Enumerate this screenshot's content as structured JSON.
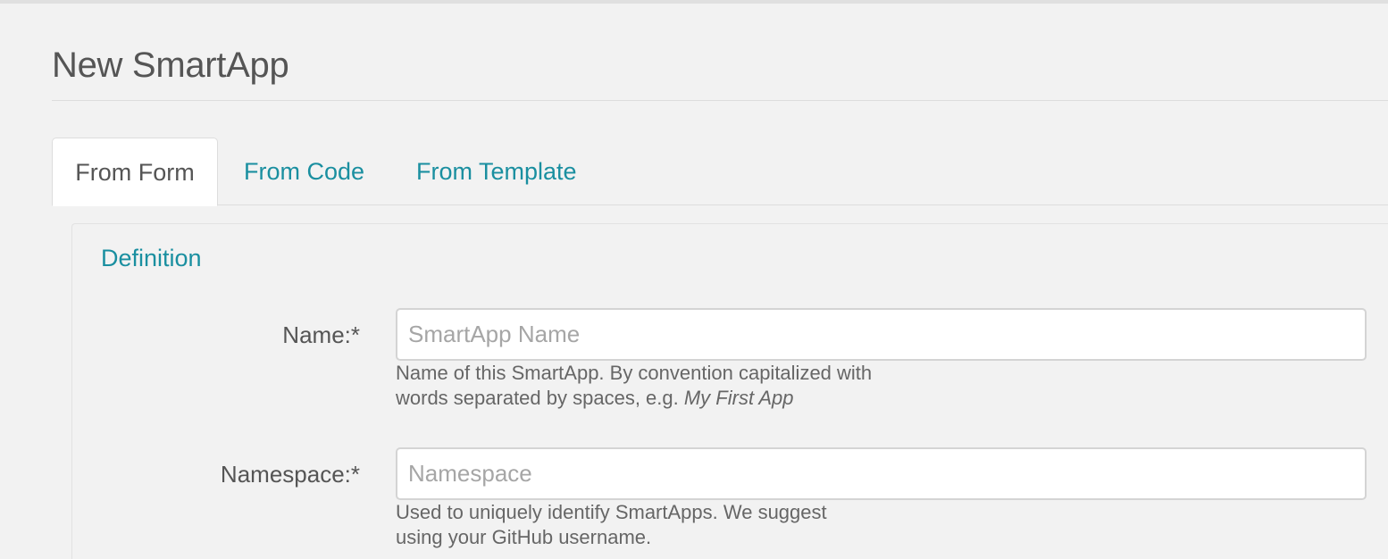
{
  "page": {
    "title": "New SmartApp"
  },
  "tabs": [
    {
      "label": "From Form",
      "active": true
    },
    {
      "label": "From Code",
      "active": false
    },
    {
      "label": "From Template",
      "active": false
    }
  ],
  "definition": {
    "section_title": "Definition",
    "fields": [
      {
        "label": "Name:*",
        "placeholder": "SmartApp Name",
        "value": "",
        "help_line1": "Name of this SmartApp. By convention capitalized with",
        "help_line2_prefix": "words separated by spaces, e.g. ",
        "help_line2_example": "My First App"
      },
      {
        "label": "Namespace:*",
        "placeholder": "Namespace",
        "value": "",
        "help_line1": "Used to uniquely identify SmartApps. We suggest",
        "help_line2_prefix": "using your GitHub username.",
        "help_line2_example": ""
      }
    ]
  },
  "colors": {
    "background": "#f2f2f2",
    "accent": "#1a8fa0",
    "text": "#555555",
    "placeholder": "#a6a6a6",
    "border": "#d4d4d4"
  }
}
